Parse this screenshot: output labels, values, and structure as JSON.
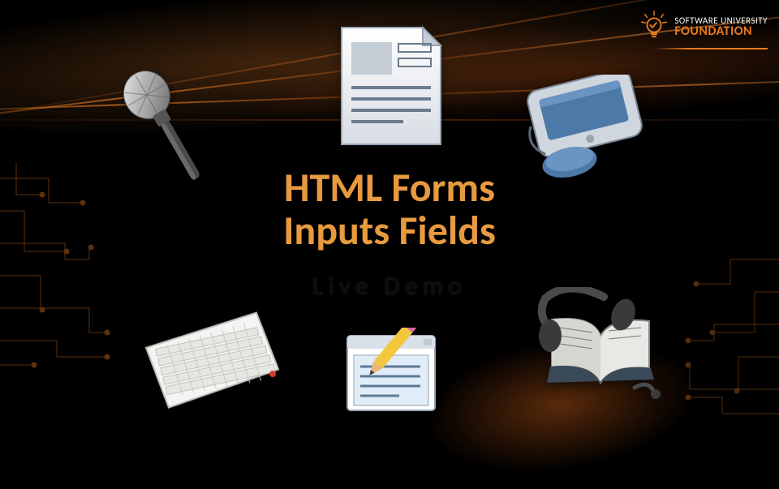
{
  "logo": {
    "line1": "SOFTWARE UNIVERSITY",
    "line2": "FOUNDATION"
  },
  "title": {
    "line1": "HTML Forms",
    "line2": "Inputs Fields"
  },
  "subtitle": "Live Demo",
  "icons": {
    "microphone": "microphone-icon",
    "form_document": "form-page-icon",
    "pda_mouse": "pda-with-mouse-icon",
    "keyboard": "keyboard-icon",
    "note_window": "text-edit-window-icon",
    "book_headphones": "open-book-with-headphones-icon",
    "lightbulb": "lightbulb-idea-icon"
  },
  "colors": {
    "accent": "#e89a3f",
    "logo_accent": "#e87b1e",
    "bg": "#000000"
  }
}
